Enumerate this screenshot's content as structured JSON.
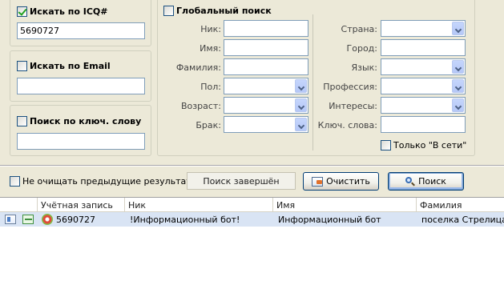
{
  "left_panel": {
    "icq": {
      "label": "Искать по ICQ#",
      "checked": true,
      "value": "5690727"
    },
    "email": {
      "label": "Искать по Email",
      "checked": false,
      "value": ""
    },
    "keyword": {
      "label": "Поиск по ключ. слову",
      "checked": false,
      "value": ""
    }
  },
  "global": {
    "label": "Глобальный поиск",
    "checked": false,
    "left_fields": {
      "nick": "Ник:",
      "name": "Имя:",
      "surname": "Фамилия:",
      "gender": "Пол:",
      "age": "Возраст:",
      "marital": "Брак:"
    },
    "right_fields": {
      "country": "Страна:",
      "city": "Город:",
      "language": "Язык:",
      "profession": "Профессия:",
      "interests": "Интересы:",
      "keywords": "Ключ. слова:"
    },
    "online_only": {
      "label": "Только \"В сети\"",
      "checked": false
    }
  },
  "bottom_bar": {
    "keep_results": {
      "label": "Не очищать предыдущие результаты",
      "checked": false
    },
    "status": "Поиск завершён",
    "clear_button": "Очистить",
    "search_button": "Поиск"
  },
  "results": {
    "columns": [
      "Учётная запись",
      "Ник",
      "Имя",
      "Фамилия"
    ],
    "rows": [
      {
        "account": "5690727",
        "nick": "!Информационный бот!",
        "name": "Информационный бот",
        "surname": "поселка Стрелица"
      }
    ]
  }
}
